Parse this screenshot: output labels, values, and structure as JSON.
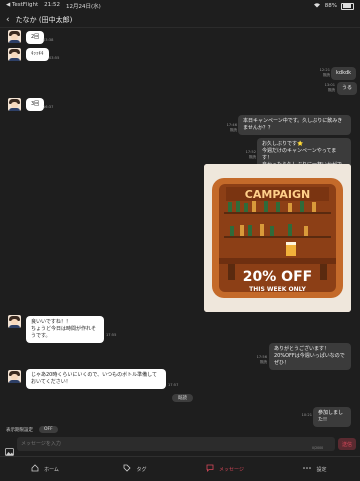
{
  "statusbar": {
    "carrier": "◀ TestFlight",
    "time": "21:52",
    "date": "12月24日(水)",
    "battery": "88%"
  },
  "header": {
    "title": "たなか (田中太郎)"
  },
  "messages": {
    "m1": {
      "text": "2回",
      "time": "03:38"
    },
    "m2": {
      "text": "ｷｯｯｷｷ",
      "time": "03:55"
    },
    "m3": {
      "text": "kdkdk",
      "time": "12:21",
      "read": "既読"
    },
    "m4": {
      "text": "うる",
      "time": "13:01",
      "read": "既読"
    },
    "m5": {
      "text": "3回",
      "time": "16:37"
    },
    "m6": {
      "text": "本日キャンペーン中です。久しぶりに飲みきませんか？？",
      "time": "17:46",
      "read": "既読"
    },
    "m7": {
      "text": "お久しぶりです⭐\n今週だけのキャンペーンやってます！\n良かったら久しぶりに一杯いかがですか？",
      "time": "17:52",
      "read": "既読"
    },
    "m8": {
      "text": "良いいですね！！\nちょうど今日は時間が作れそうです。",
      "time": "17:55"
    },
    "m9": {
      "text": "ありがとうございます！\n20%OFFは今週いっぱいなのでぜひ！",
      "time": "17:56",
      "read": "既読"
    },
    "m10": {
      "text": "じゃあ20時くらいにいくので、いつものボトル準備しておいてください！",
      "time": "17:57"
    },
    "m11": {
      "text": "参加しました!!",
      "time": "10:21"
    }
  },
  "promo": {
    "title": "CAMPAIGN",
    "discount": "20% OFF",
    "subtitle": "THIS WEEK ONLY"
  },
  "date_divider": "既読",
  "composer": {
    "display_setting_label": "表示期限設定",
    "display_setting_value": "OFF",
    "placeholder": "メッセージを入力",
    "counter": "0/2000",
    "send_label": "送信"
  },
  "tabs": [
    {
      "label": "ホーム",
      "icon": "home-icon"
    },
    {
      "label": "タグ",
      "icon": "tag-icon"
    },
    {
      "label": "メッセージ",
      "icon": "message-icon"
    },
    {
      "label": "設定",
      "icon": "more-icon"
    }
  ],
  "colors": {
    "accent": "#d9485a",
    "background": "#1e1e1e",
    "bubble_out": "#3b3b3b",
    "bubble_in": "#ffffff"
  }
}
